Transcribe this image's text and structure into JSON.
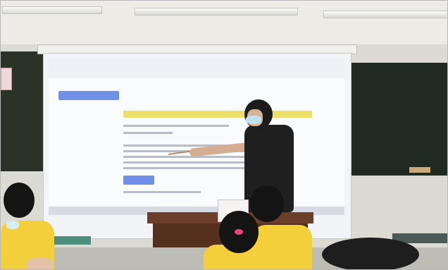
{
  "scene": {
    "description_tag": "classroom-lesson",
    "projected_page": {
      "tab_labels": [],
      "header_button": "",
      "yellow_title": "",
      "meta_line": "",
      "blue_button": ""
    },
    "chalkboard_right_lines": [],
    "sign_text": "",
    "colors": {
      "screen_bg": "#fafbfd",
      "highlight_yellow": "#ede06a",
      "button_blue": "#6f8fe8",
      "chalkboard_green": "#1f2b22",
      "uniform_yellow": "#f2cf3b",
      "teacher_black": "#1f1f1f",
      "desk_brown": "#6b3d2b"
    }
  }
}
